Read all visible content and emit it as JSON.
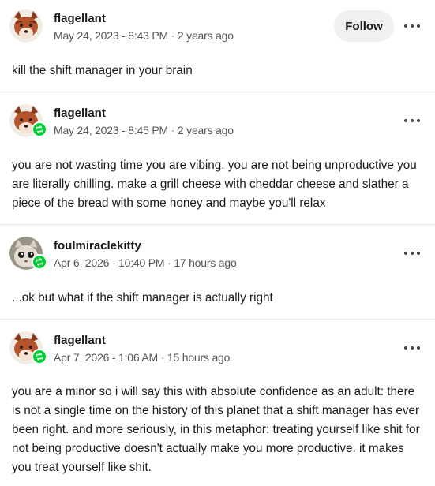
{
  "colors": {
    "reblog_badge": "#00cf35",
    "follow_button_bg": "#f0f0f0",
    "divider": "#e6e6e6",
    "meta_text": "#555555"
  },
  "posts": [
    {
      "username": "flagellant",
      "date": "May 24, 2023 - 8:43 PM",
      "relative_time": "2 years ago",
      "body": "kill the shift manager in your brain",
      "follow_label": "Follow",
      "avatar_icon": "fox-avatar",
      "more_icon": "more-options-icon"
    },
    {
      "username": "flagellant",
      "date": "May 24, 2023 - 8:45 PM",
      "relative_time": "2 years ago",
      "body": "you are not wasting time you are vibing. you are not being unproductive you are literally chilling. make a grill cheese with cheddar cheese and slather a piece of the bread with some honey and maybe you'll relax",
      "avatar_icon": "fox-avatar",
      "badge_icon": "reblog-icon",
      "more_icon": "more-options-icon"
    },
    {
      "username": "foulmiraclekitty",
      "date": "Apr 6, 2026 - 10:40 PM",
      "relative_time": "17 hours ago",
      "body": "...ok but what if the shift manager is actually right",
      "avatar_icon": "cat-avatar",
      "badge_icon": "reblog-icon",
      "more_icon": "more-options-icon"
    },
    {
      "username": "flagellant",
      "date": "Apr 7, 2026 - 1:06 AM",
      "relative_time": "15 hours ago",
      "body": "you are a minor so i will say this with absolute confidence as an adult: there is not a single time on the history of this planet that a shift manager has ever been right. and more seriously, in this metaphor: treating yourself like shit for not being productive doesn't actually make you more productive. it makes you treat yourself like shit.",
      "avatar_icon": "fox-avatar",
      "badge_icon": "reblog-icon",
      "more_icon": "more-options-icon"
    }
  ],
  "separator": "·"
}
